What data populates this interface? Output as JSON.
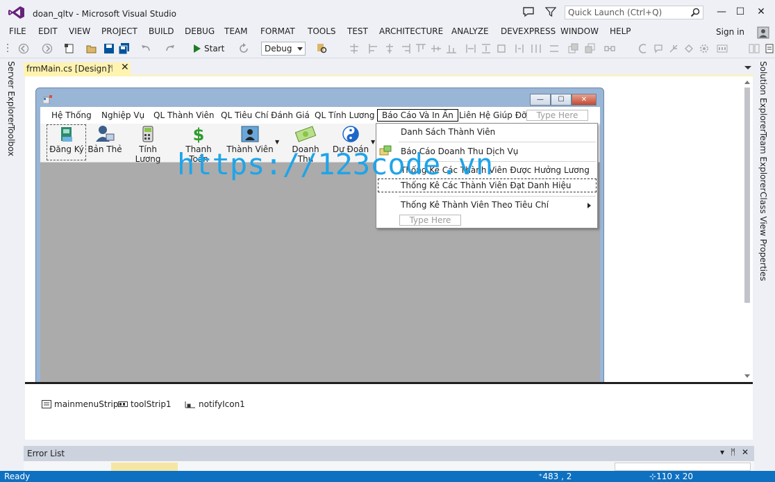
{
  "window": {
    "title": "doan_qltv - Microsoft Visual Studio",
    "quick_launch_placeholder": "Quick Launch (Ctrl+Q)",
    "minimize": "—",
    "restore": "☐",
    "close": "✕"
  },
  "menu": [
    "FILE",
    "EDIT",
    "VIEW",
    "PROJECT",
    "BUILD",
    "DEBUG",
    "TEAM",
    "FORMAT",
    "TOOLS",
    "TEST",
    "ARCHITECTURE",
    "ANALYZE",
    "DEVEXPRESS",
    "WINDOW",
    "HELP"
  ],
  "sign_in": "Sign in",
  "toolbar": {
    "start_label": "Start",
    "config_value": "Debug"
  },
  "left_rail": [
    "Server Explorer",
    "Toolbox"
  ],
  "right_rail": [
    "Solution Explorer",
    "Team Explorer",
    "Class View",
    "Properties"
  ],
  "doc_tab": {
    "label": "frmMain.cs [Design]",
    "pin": "ᛗ",
    "close": "✕"
  },
  "form": {
    "menustrip": [
      "Hệ Thống",
      "Nghiệp Vụ",
      "QL Thành Viên",
      "QL Tiêu Chí Đánh Giá",
      "QL Tính Lương"
    ],
    "menustrip_active": "Báo Cáo Và In Ấn",
    "menustrip_after": "Liên Hệ Giúp Đỡ",
    "type_here": "Type Here",
    "toolstrip": [
      "Đăng Ký",
      "Bản Thẻ",
      "Tính Lương",
      "Thanh Toán",
      "Thành Viên",
      "Doanh Thu",
      "Dự Đoán"
    ]
  },
  "dropdown": {
    "items": [
      "Danh Sách Thành Viên",
      "Báo Cáo Doanh Thu Dịch Vụ",
      "Thống Kê Các Thành Viên Được Hưởng Lương",
      "Thống Kê Các Thành Viên Đạt Danh Hiệu",
      "Thống Kê Thành Viên Theo Tiêu Chí"
    ],
    "type_here": "Type Here"
  },
  "watermark": "https://123code.vn",
  "tray": [
    "mainmenuStrip",
    "toolStrip1",
    "notifyIcon1"
  ],
  "error_list": {
    "title": "Error List",
    "controls": [
      "▾",
      "ᛗ",
      "✕"
    ]
  },
  "status": {
    "text": "Ready",
    "position": "483 , 2",
    "size": "110 x 20"
  },
  "colors": {
    "status_bar": "#0e70c0",
    "watermark": "#1fa4e8",
    "tab_active": "#fff3b0"
  }
}
